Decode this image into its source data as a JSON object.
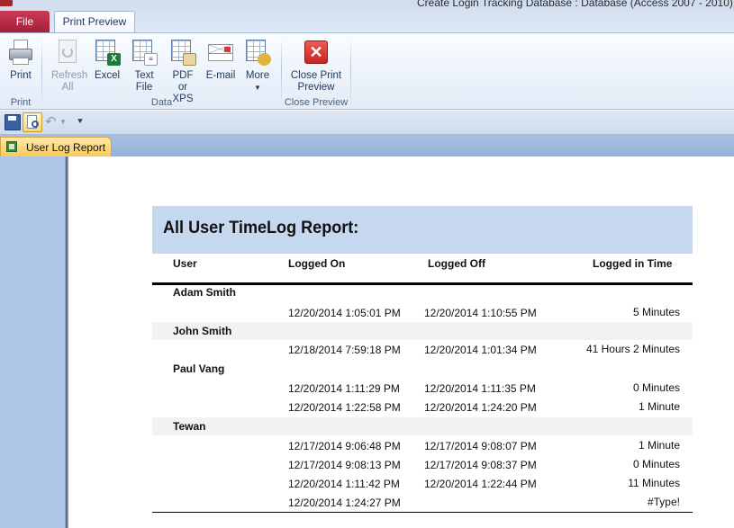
{
  "window": {
    "title": "Create Login Tracking Database : Database (Access 2007 - 2010) - M"
  },
  "tabs": {
    "file": "File",
    "print_preview": "Print Preview"
  },
  "ribbon": {
    "print_group": {
      "label": "Print",
      "print_button": "Print"
    },
    "data_group": {
      "label": "Data",
      "refresh": "Refresh All",
      "excel": "Excel",
      "text_file": "Text File",
      "pdf_xps": "PDF or XPS",
      "email": "E-mail",
      "more": "More"
    },
    "close_group": {
      "label": "Close Preview",
      "close_button": "Close Print Preview"
    }
  },
  "document_tab": {
    "label": "User Log Report"
  },
  "report": {
    "title": "All User TimeLog Report:",
    "columns": {
      "user": "User",
      "logged_on": "Logged On",
      "logged_off": "Logged Off",
      "logged_in_time": "Logged in Time"
    },
    "groups": [
      {
        "user": "Adam  Smith",
        "rows": [
          {
            "on": "12/20/2014 1:05:01 PM",
            "off": "12/20/2014 1:10:55 PM",
            "time": "5 Minutes"
          }
        ]
      },
      {
        "user": "John  Smith",
        "rows": [
          {
            "on": "12/18/2014 7:59:18 PM",
            "off": "12/20/2014 1:01:34 PM",
            "time": "41 Hours 2 Minutes"
          }
        ]
      },
      {
        "user": "Paul Vang",
        "rows": [
          {
            "on": "12/20/2014 1:11:29 PM",
            "off": "12/20/2014 1:11:35 PM",
            "time": "0 Minutes"
          },
          {
            "on": "12/20/2014 1:22:58 PM",
            "off": "12/20/2014 1:24:20 PM",
            "time": "1 Minute"
          }
        ]
      },
      {
        "user": "Tewan",
        "rows": [
          {
            "on": "12/17/2014 9:06:48 PM",
            "off": "12/17/2014 9:08:07 PM",
            "time": "1 Minute"
          },
          {
            "on": "12/17/2014 9:08:13 PM",
            "off": "12/17/2014 9:08:37 PM",
            "time": "0 Minutes"
          },
          {
            "on": "12/20/2014 1:11:42 PM",
            "off": "12/20/2014 1:22:44 PM",
            "time": "11 Minutes"
          },
          {
            "on": "12/20/2014 1:24:27 PM",
            "off": "",
            "time": "#Type!"
          }
        ]
      }
    ]
  }
}
